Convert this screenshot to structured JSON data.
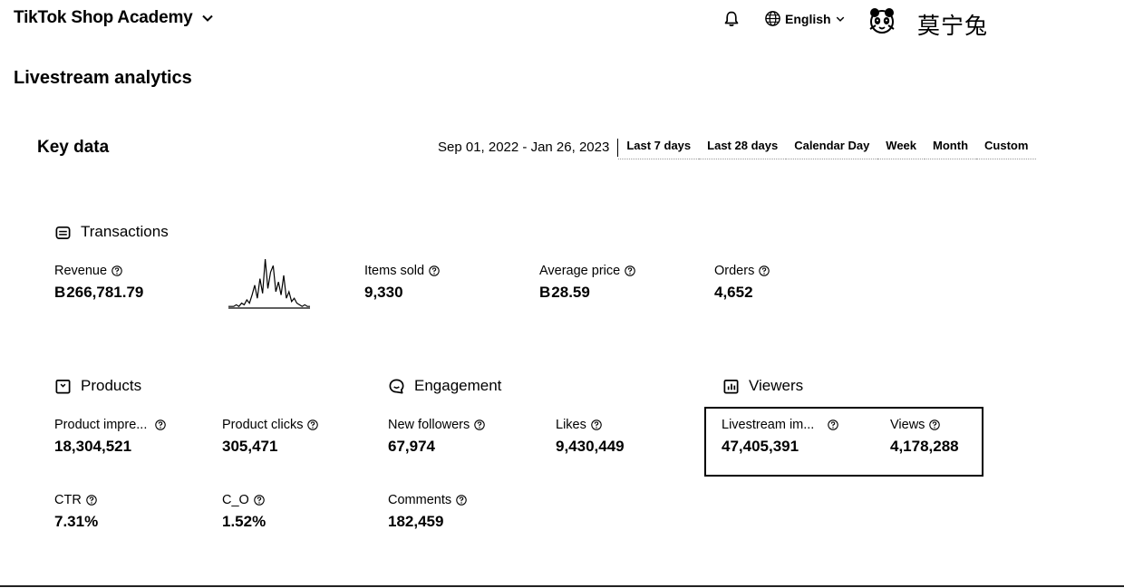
{
  "header": {
    "brand": "TikTok Shop Academy",
    "language": "English",
    "username": "莫宁兔"
  },
  "page": {
    "title": "Livestream analytics"
  },
  "key_data": {
    "title": "Key data",
    "date_range": "Sep 01, 2022 - Jan 26, 2023",
    "periods": [
      "Last 7 days",
      "Last 28 days",
      "Calendar Day",
      "Week",
      "Month",
      "Custom"
    ]
  },
  "sections": {
    "transactions": {
      "title": "Transactions",
      "revenue": {
        "label": "Revenue",
        "currency": "B",
        "value": "266,781.79"
      },
      "items_sold": {
        "label": "Items sold",
        "value": "9,330"
      },
      "average_price": {
        "label": "Average price",
        "currency": "B",
        "value": "28.59"
      },
      "orders": {
        "label": "Orders",
        "value": "4,652"
      }
    },
    "products": {
      "title": "Products",
      "product_impressions": {
        "label": "Product impre...",
        "value": "18,304,521"
      },
      "product_clicks": {
        "label": "Product clicks",
        "value": "305,471"
      },
      "ctr": {
        "label": "CTR",
        "value": "7.31%"
      },
      "c_o": {
        "label": "C_O",
        "value": "1.52%"
      }
    },
    "engagement": {
      "title": "Engagement",
      "new_followers": {
        "label": "New followers",
        "value": "67,974"
      },
      "likes": {
        "label": "Likes",
        "value": "9,430,449"
      },
      "comments": {
        "label": "Comments",
        "value": "182,459"
      }
    },
    "viewers": {
      "title": "Viewers",
      "livestream_impressions": {
        "label": "Livestream im...",
        "value": "47,405,391"
      },
      "views": {
        "label": "Views",
        "value": "4,178,288"
      }
    }
  },
  "sparkline": {
    "values": [
      1,
      1,
      1,
      2,
      1,
      3,
      2,
      5,
      3,
      8,
      14,
      6,
      18,
      9,
      30,
      12,
      22,
      26,
      10,
      16,
      8,
      20,
      6,
      10,
      4,
      6,
      3,
      2,
      1,
      2,
      1,
      1
    ]
  },
  "icons": {
    "bell": "bell-icon",
    "globe": "globe-icon",
    "help": "help-circle-icon",
    "transactions": "receipt-icon",
    "products": "box-icon",
    "engagement": "chat-icon",
    "viewers": "viewers-icon"
  }
}
